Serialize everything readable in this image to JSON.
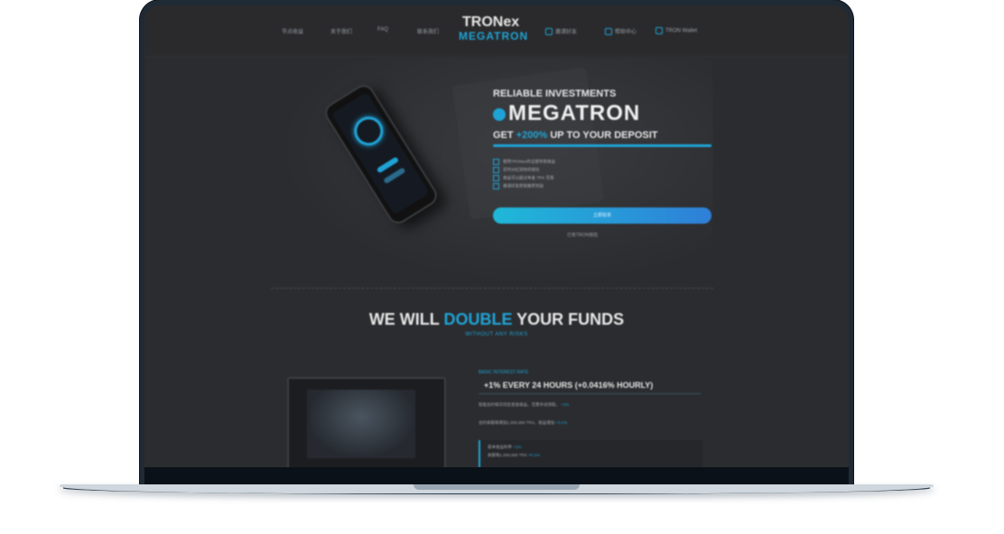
{
  "nav": {
    "items": [
      "节点收益",
      "关于我们",
      "FAQ",
      "联系我们"
    ],
    "right_items": [
      "邀请好友",
      "帮助中心",
      "TRON Wallet"
    ]
  },
  "logo": {
    "top": "TRONex",
    "bottom": "MEGATRON"
  },
  "hero": {
    "subtitle": "RELIABLE INVESTMENTS",
    "title": "MEGATRON",
    "line_prefix": "GET",
    "line_accent": "+200%",
    "line_suffix": "UP TO YOUR DEPOSIT",
    "features": [
      "使用TRONex的全部存款收益",
      "实时分红到你的钱包",
      "收益可以超过本金 TRX 无限",
      "邀请好友获取推荐奖励"
    ],
    "cta_label": "立即投资",
    "cta_note": "已有TRON钱包"
  },
  "section": {
    "title_prefix": "WE WILL",
    "title_accent": "DOUBLE",
    "title_suffix": "YOUR FUNDS",
    "subtitle": "WITHOUT ANY RISKS"
  },
  "rate": {
    "label": "BASIC INTEREST RATE",
    "title": "+1% EVERY 24 HOURS (+0.0416% HOURLY)",
    "desc1": "智能合约每日向您发放收益，无需手动领取。",
    "desc1_accent": "+1%",
    "desc2": "合约余额每增加1,000,000 TRX，收益增加",
    "desc2_accent": "+0.1%",
    "box_line1": "基本收益利率",
    "box_line1_accent": "+1%",
    "box_line2": "余额每1,000,000 TRX",
    "box_line2_accent": "+0.1%"
  },
  "colors": {
    "accent": "#1fa3d6",
    "background": "#2b2c2f",
    "frame": "#1f2a35"
  }
}
